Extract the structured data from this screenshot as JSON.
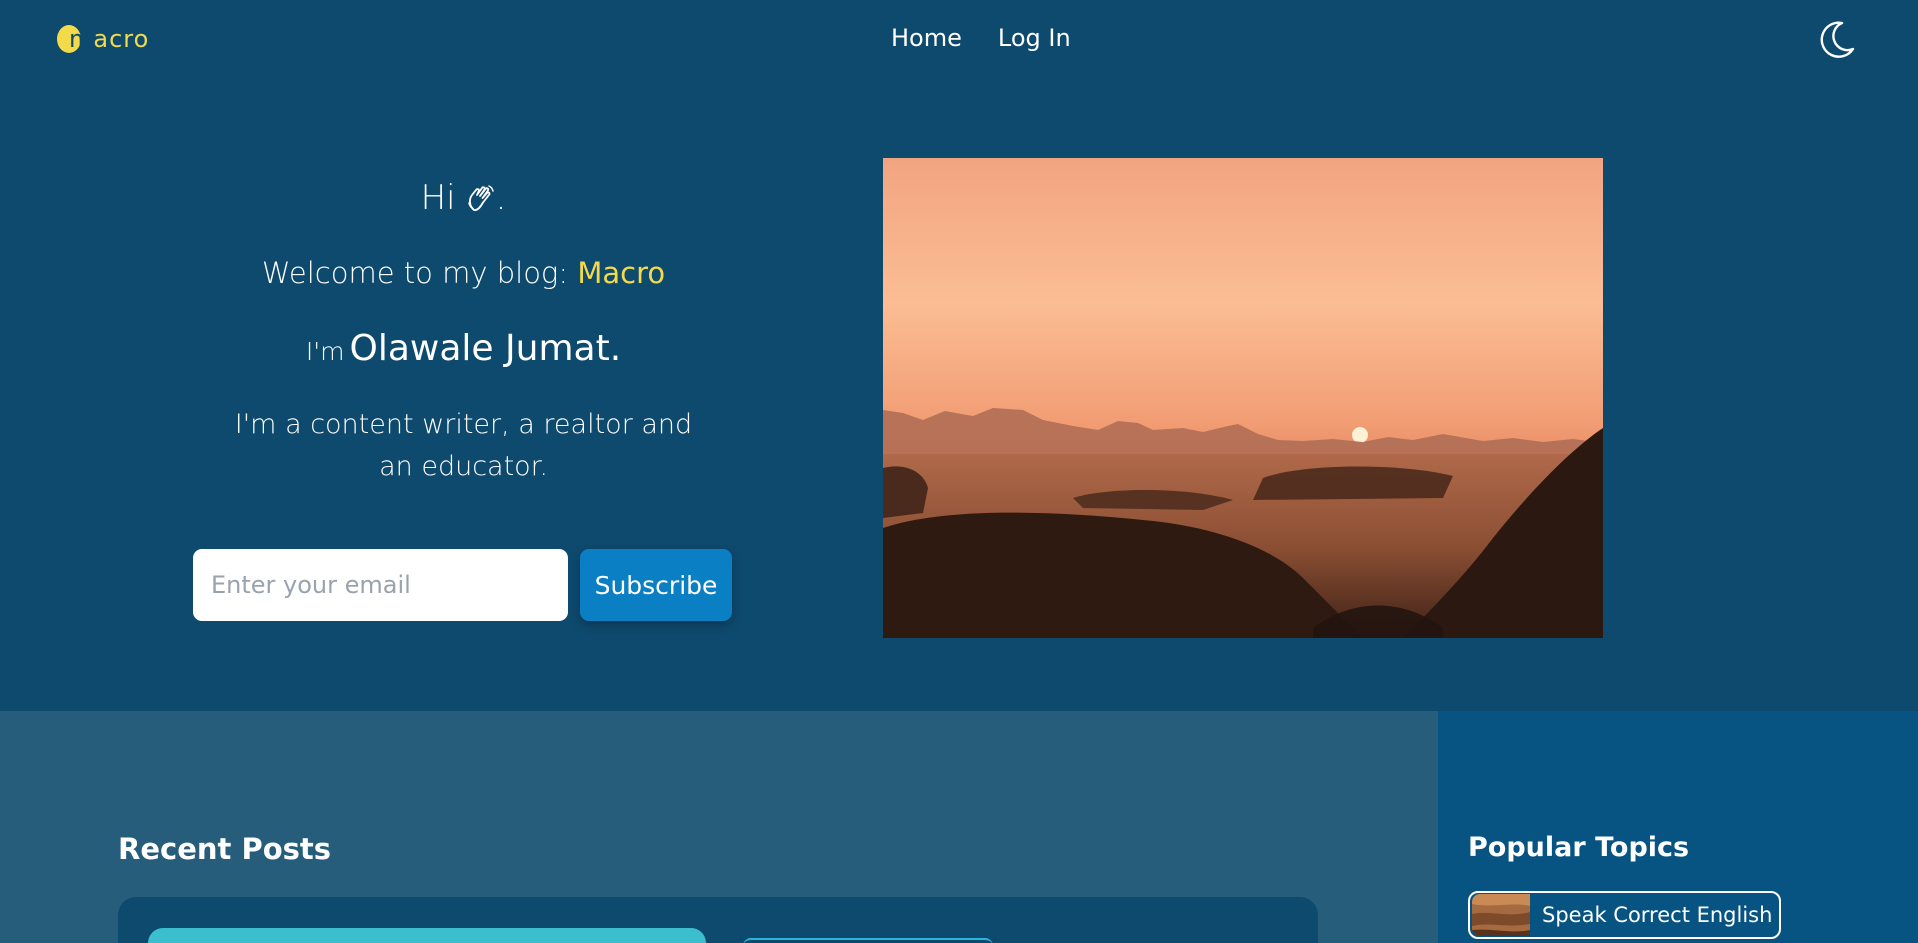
{
  "header": {
    "logo": {
      "first_letter": "m",
      "rest": "acro"
    },
    "nav": [
      {
        "label": "Home"
      },
      {
        "label": "Log In"
      }
    ],
    "theme_toggle_icon": "moon-icon"
  },
  "hero": {
    "greeting": "Hi",
    "greeting_icon": "waving-hand-icon",
    "greeting_end": ".",
    "welcome_prefix": "Welcome to my blog: ",
    "blog_name": "Macro",
    "iam_prefix": "I'm",
    "author_name": "Olawale Jumat.",
    "bio": "I'm a content writer, a realtor and an educator.",
    "email_placeholder": "Enter your email",
    "subscribe_label": "Subscribe"
  },
  "recent": {
    "title": "Recent Posts"
  },
  "popular": {
    "title": "Popular Topics",
    "topics": [
      {
        "label": "Speak Correct English"
      }
    ]
  },
  "colors": {
    "background": "#0e4a6e",
    "accent_yellow": "#f2da4b",
    "button_blue": "#0a7fc4",
    "recent_bg": "#265d7a",
    "popular_bg": "#075482"
  }
}
